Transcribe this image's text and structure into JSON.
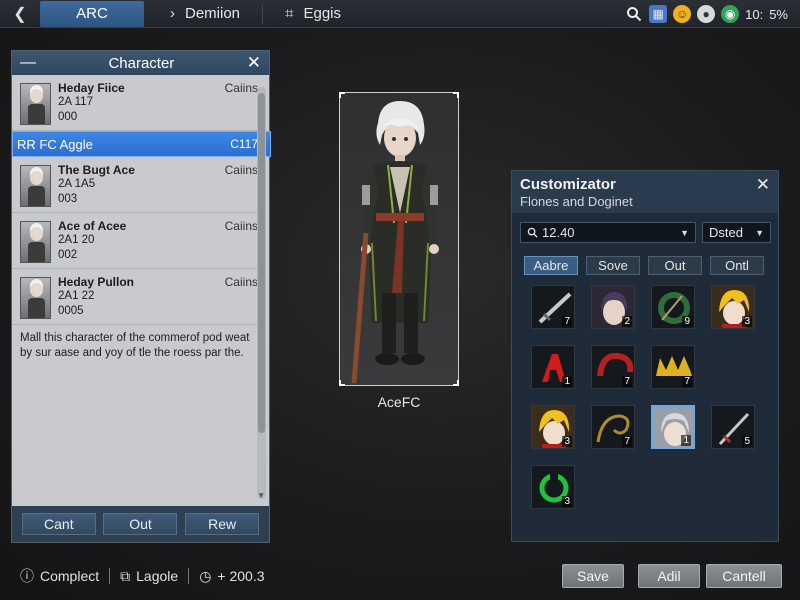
{
  "topbar": {
    "back_icon": "chevron-left-icon",
    "tabs": [
      {
        "label": "ARC",
        "glyph": "",
        "active": true
      },
      {
        "label": "Demiion",
        "glyph": "›",
        "active": false
      },
      {
        "label": "Eggis",
        "glyph": "⌗",
        "active": false
      }
    ],
    "status_icons": [
      "search-icon",
      "store-icon",
      "emoji-icon",
      "apple-icon",
      "wifi-icon"
    ],
    "time": "10:",
    "battery": "5%"
  },
  "character_panel": {
    "title": "Character",
    "items": [
      {
        "name": "Heday Fiice",
        "meta1": "2A 117",
        "meta2": "000",
        "tag": "Caiins"
      },
      {
        "name": "The Bugt Ace",
        "meta1": "2A 1A5",
        "meta2": "003",
        "tag": "Caiins"
      },
      {
        "name": "Ace of Acee",
        "meta1": "2A1 20",
        "meta2": "002",
        "tag": "Caiins"
      },
      {
        "name": "Heday Pullon",
        "meta1": "2A1 22",
        "meta2": "0005",
        "tag": "Caiins"
      }
    ],
    "selected": {
      "name": "RR FC Aggle",
      "code": "C117"
    },
    "description": "Mall this character of the commerof pod weat by sur aase and yoy of tle the roess par the.",
    "footer_buttons": [
      "Cant",
      "Out",
      "Rew"
    ]
  },
  "preview": {
    "label": "AceFC"
  },
  "customizator": {
    "title": "Customizator",
    "subtitle": "Flones and Doginet",
    "search_value": "12.40",
    "select_value": "Dsted",
    "tabs": [
      "Aabre",
      "Sove",
      "Out",
      "Ontl"
    ],
    "active_tab": 0,
    "items": [
      {
        "icon": "sword-icon",
        "count": "7"
      },
      {
        "icon": "dark-hair-portrait-icon",
        "count": "2"
      },
      {
        "icon": "green-ring-icon",
        "count": "9"
      },
      {
        "icon": "blonde-portrait-icon",
        "count": "3"
      },
      {
        "icon": "red-rune-icon",
        "count": "1"
      },
      {
        "icon": "red-arc-icon",
        "count": "7"
      },
      {
        "icon": "gold-crown-icon",
        "count": "7"
      },
      {
        "icon": "blonde-portrait-icon",
        "count": "3"
      },
      {
        "icon": "gold-whip-icon",
        "count": "7"
      },
      {
        "icon": "silver-hair-portrait-icon",
        "count": "1"
      },
      {
        "icon": "dagger-icon",
        "count": "5"
      },
      {
        "icon": "green-ring-icon",
        "count": "3"
      }
    ]
  },
  "statusbar": {
    "complete": "Complect",
    "lagole": "Lagole",
    "value": "+ 200.3"
  },
  "bottom_buttons": {
    "save": "Save",
    "add": "Adil",
    "cancel": "Cantell"
  },
  "colors": {
    "accent": "#3a86e6",
    "panel_header": "#2f465e",
    "panel_body": "#c8cacd",
    "cust_bg": "#1f2b38"
  }
}
